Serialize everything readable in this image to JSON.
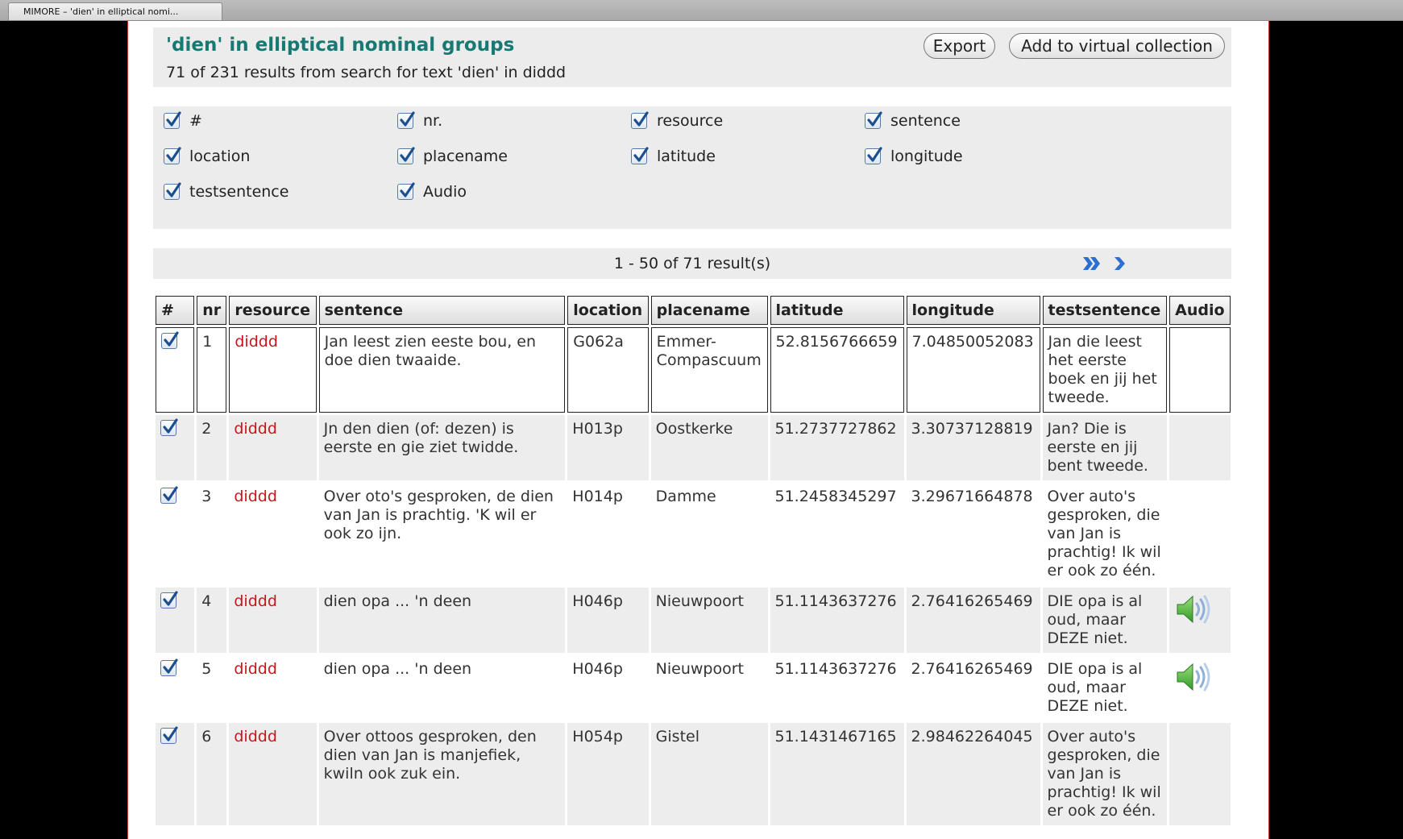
{
  "window": {
    "tab_title": "MIMORE – 'dien' in elliptical nomi..."
  },
  "header": {
    "title": "'dien' in elliptical nominal groups",
    "subtitle": "71 of 231 results from search for text 'dien' in diddd",
    "export_label": "Export",
    "add_virtual_label": "Add to virtual collection"
  },
  "columns": [
    {
      "label": "#",
      "checked": true
    },
    {
      "label": "nr.",
      "checked": true
    },
    {
      "label": "resource",
      "checked": true
    },
    {
      "label": "sentence",
      "checked": true
    },
    {
      "label": "location",
      "checked": true
    },
    {
      "label": "placename",
      "checked": true
    },
    {
      "label": "latitude",
      "checked": true
    },
    {
      "label": "longitude",
      "checked": true
    },
    {
      "label": "testsentence",
      "checked": true
    },
    {
      "label": "Audio",
      "checked": true
    }
  ],
  "pager": {
    "text": "1 - 50 of 71 result(s)"
  },
  "table": {
    "headers": [
      "#",
      "nr",
      "resource",
      "sentence",
      "location",
      "placename",
      "latitude",
      "longitude",
      "testsentence",
      "Audio"
    ],
    "rows": [
      {
        "nr": "1",
        "resource": "diddd",
        "sentence": "Jan leest zien eeste bou, en doe dien twaaide.",
        "location": "G062a",
        "placename": "Emmer-Compascuum",
        "latitude": "52.8156766659",
        "longitude": "7.04850052083",
        "testsentence": "Jan die leest het eerste boek en jij het tweede.",
        "audio": false
      },
      {
        "nr": "2",
        "resource": "diddd",
        "sentence": "Jn den dien (of: dezen) is eerste en gie ziet twidde.",
        "location": "H013p",
        "placename": "Oostkerke",
        "latitude": "51.2737727862",
        "longitude": "3.30737128819",
        "testsentence": "Jan? Die is eerste en jij bent tweede.",
        "audio": false
      },
      {
        "nr": "3",
        "resource": "diddd",
        "sentence": "Over oto's gesproken, de dien van Jan is prachtig. 'K wil er ook zo ijn.",
        "location": "H014p",
        "placename": "Damme",
        "latitude": "51.2458345297",
        "longitude": "3.29671664878",
        "testsentence": "Over auto's gesproken, die van Jan is prachtig! Ik wil er ook zo één.",
        "audio": false
      },
      {
        "nr": "4",
        "resource": "diddd",
        "sentence": "dien opa ... 'n deen",
        "location": "H046p",
        "placename": "Nieuwpoort",
        "latitude": "51.1143637276",
        "longitude": "2.76416265469",
        "testsentence": "DIE opa is al oud, maar DEZE niet.",
        "audio": true
      },
      {
        "nr": "5",
        "resource": "diddd",
        "sentence": "dien opa ... 'n deen",
        "location": "H046p",
        "placename": "Nieuwpoort",
        "latitude": "51.1143637276",
        "longitude": "2.76416265469",
        "testsentence": "DIE opa is al oud, maar DEZE niet.",
        "audio": true
      },
      {
        "nr": "6",
        "resource": "diddd",
        "sentence": "Over ottoos gesproken, den dien van Jan is manjefiek, kwiln ook zuk ein.",
        "location": "H054p",
        "placename": "Gistel",
        "latitude": "51.1431467165",
        "longitude": "2.98462264045",
        "testsentence": "Over auto's gesproken, die van Jan is prachtig! Ik wil er ook zo één.",
        "audio": false
      }
    ]
  },
  "colors": {
    "title": "#167a72",
    "resource_link": "#c8141c",
    "pager_arrows": "#2a6fd1"
  }
}
